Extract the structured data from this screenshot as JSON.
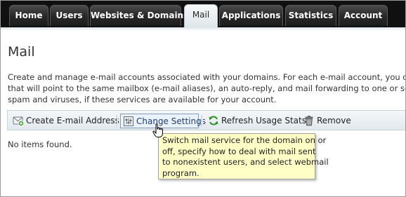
{
  "topnav": {
    "tabs": [
      {
        "label": "Home"
      },
      {
        "label": "Users"
      },
      {
        "label": "Websites & Domains"
      },
      {
        "label": "Mail"
      },
      {
        "label": "Applications"
      },
      {
        "label": "Statistics"
      },
      {
        "label": "Account"
      }
    ],
    "active_tab": "Mail"
  },
  "page": {
    "title": "Mail",
    "description_lines": [
      "Create and manage e-mail accounts associated with your domains. For each e-mail account, you can set up",
      "that will point to the same mailbox (e-mail aliases), an auto-reply, and mail forwarding to one or several e",
      "spam and viruses, if these services are available for your account."
    ]
  },
  "toolbar": {
    "create_label": "Create E-mail Address",
    "change_settings_label": "Change Settings",
    "refresh_label": "Refresh Usage Stats",
    "remove_label": "Remove",
    "icons": {
      "create": "envelope-plus-icon",
      "change_settings": "settings-sliders-icon",
      "refresh": "refresh-icon",
      "remove": "trash-icon"
    }
  },
  "list": {
    "empty_text": "No items found."
  },
  "tooltip": {
    "lines": [
      "Switch mail service for the domain on or",
      "off, specify how to deal with mail sent",
      "to nonexistent users, and select webmail",
      "program."
    ]
  },
  "colors": {
    "nav_background": "#101010",
    "active_tab": "#dfe6ea",
    "toolbar": "#e2e9ee",
    "tooltip_background": "#ffffc6",
    "hover_border": "#7f9db9"
  }
}
